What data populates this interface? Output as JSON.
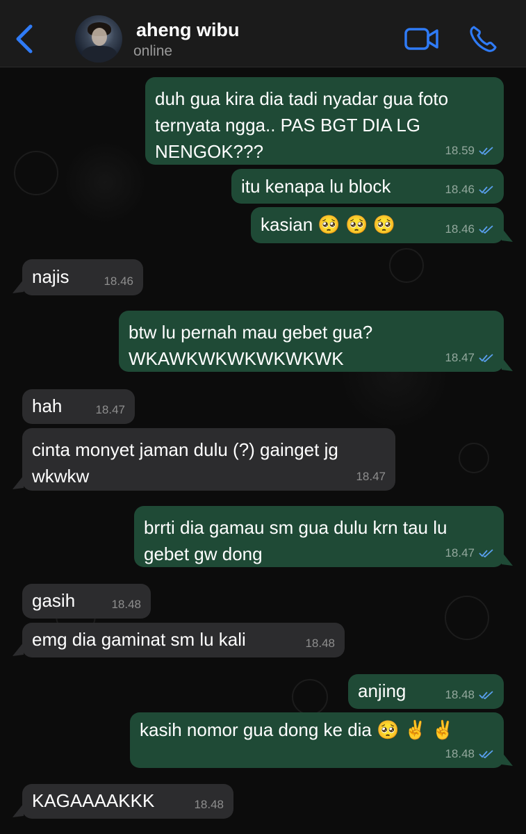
{
  "contact": {
    "name": "aheng wibu",
    "status": "online"
  },
  "icons": {
    "back": "chevron-left-icon",
    "video": "video-camera-icon",
    "call": "phone-icon",
    "read": "double-check-icon"
  },
  "colors": {
    "accent": "#2f7bf6",
    "outgoing": "#1f4a36",
    "incoming": "#2c2c2e",
    "header": "#1b1b1b"
  },
  "messages": [
    {
      "dir": "out",
      "text": "duh gua kira dia tadi nyadar gua foto ternyata ngga.. PAS BGT DIA LG NENGOK???",
      "time": "18.59",
      "read": true
    },
    {
      "dir": "out",
      "text": "itu kenapa lu block",
      "time": "18.46",
      "read": true
    },
    {
      "dir": "out",
      "text": "kasian 🥺 🥺 🥺",
      "time": "18.46",
      "read": true
    },
    {
      "dir": "in",
      "text": "najis",
      "time": "18.46"
    },
    {
      "dir": "out",
      "text": "btw lu pernah mau gebet gua? WKAWKWKWKWKWKWK",
      "time": "18.47",
      "read": true
    },
    {
      "dir": "in",
      "text": "hah",
      "time": "18.47"
    },
    {
      "dir": "in",
      "text": "cinta monyet jaman dulu (?) gainget jg wkwkw",
      "time": "18.47"
    },
    {
      "dir": "out",
      "text": "brrti dia gamau sm gua dulu krn tau lu gebet gw dong",
      "time": "18.47",
      "read": true
    },
    {
      "dir": "in",
      "text": "gasih",
      "time": "18.48"
    },
    {
      "dir": "in",
      "text": "emg dia gaminat sm lu kali",
      "time": "18.48"
    },
    {
      "dir": "out",
      "text": "anjing",
      "time": "18.48",
      "read": true
    },
    {
      "dir": "out",
      "text": "kasih nomor gua dong ke dia 🥺 ✌️ ✌️",
      "time": "18.48",
      "read": true
    },
    {
      "dir": "in",
      "text": "KAGAAAAKKK",
      "time": "18.48"
    }
  ]
}
